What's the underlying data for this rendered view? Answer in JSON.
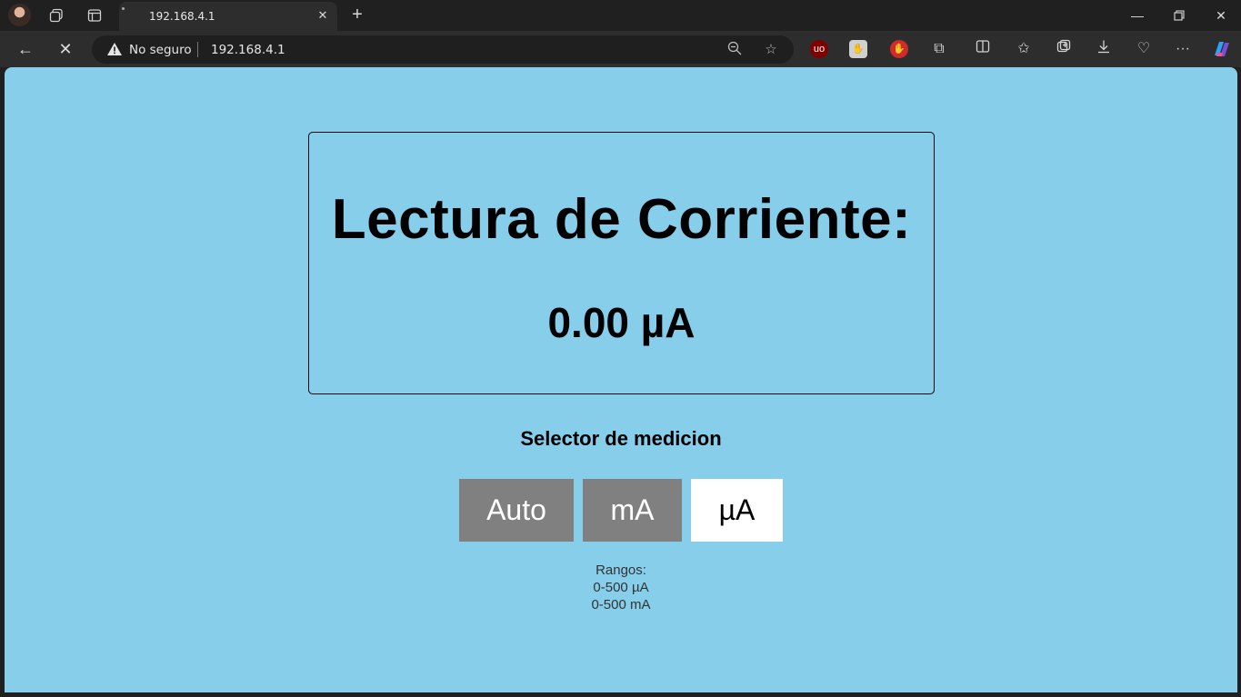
{
  "browser": {
    "tab_title": "192.168.4.1",
    "security_label": "No seguro",
    "url": "192.168.4.1"
  },
  "page": {
    "reading_title": "Lectura de Corriente:",
    "reading_value": "0.00 µA",
    "selector_title": "Selector de medicion",
    "modes": [
      {
        "label": "Auto",
        "active": false
      },
      {
        "label": "mA",
        "active": false
      },
      {
        "label": "µA",
        "active": true
      }
    ],
    "ranges_title": "Rangos:",
    "ranges": [
      "0-500 µA",
      "0-500 mA"
    ]
  },
  "colors": {
    "page_background": "#87ceeb",
    "button_inactive": "#808080",
    "button_active": "#ffffff"
  }
}
